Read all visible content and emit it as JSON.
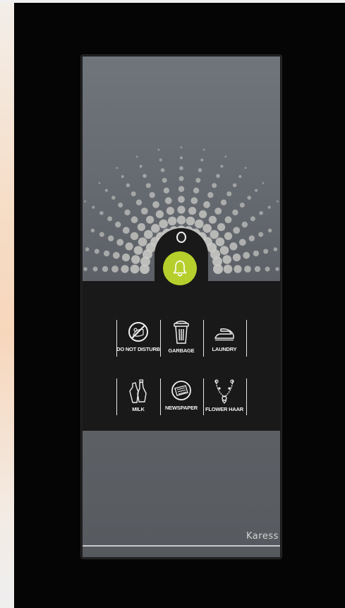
{
  "panel": {
    "accent_color": "#b6cf2c",
    "center_button_icon": "bell-icon",
    "services": [
      {
        "label": "DO NOT DISTURB",
        "icon": "do-not-disturb-icon"
      },
      {
        "label": "GARBAGE",
        "icon": "garbage-icon"
      },
      {
        "label": "LAUNDRY",
        "icon": "iron-icon"
      },
      {
        "label": "MILK",
        "icon": "milk-bottles-icon"
      },
      {
        "label": "NEWSPAPER",
        "icon": "newspaper-icon"
      },
      {
        "label": "FLOWER HAAR",
        "icon": "flower-garland-icon"
      }
    ],
    "brand": "Karess"
  }
}
